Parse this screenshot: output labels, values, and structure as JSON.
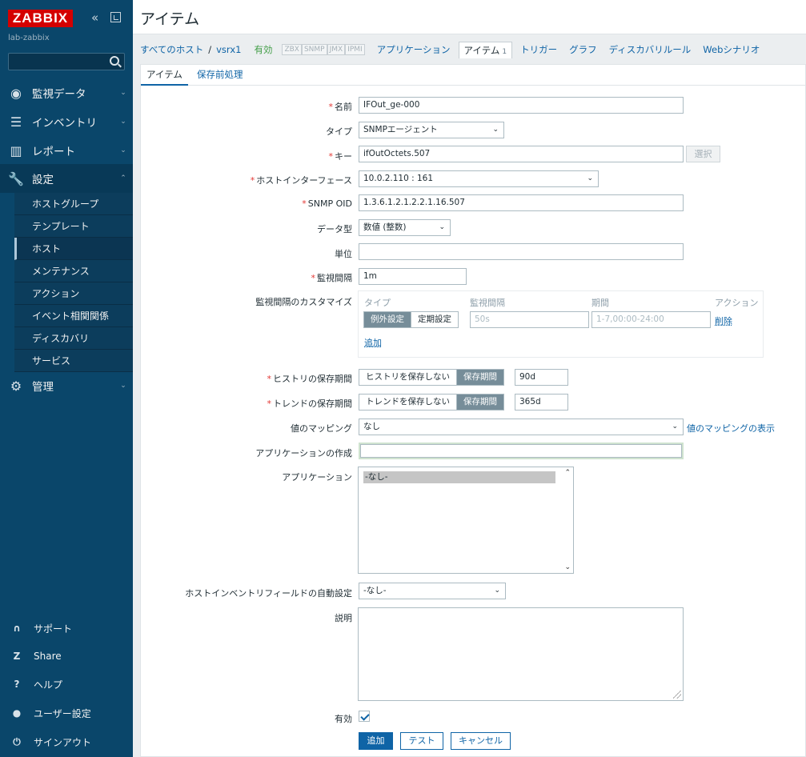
{
  "app": {
    "logo": "ZABBIX",
    "server_name": "lab-zabbix"
  },
  "sidebar": {
    "search_placeholder": "",
    "menu": [
      {
        "label": "監視データ",
        "icon": "eye-icon"
      },
      {
        "label": "インベントリ",
        "icon": "list-icon"
      },
      {
        "label": "レポート",
        "icon": "bar-chart-icon"
      },
      {
        "label": "設定",
        "icon": "wrench-icon"
      },
      {
        "label": "管理",
        "icon": "gear-icon"
      }
    ],
    "submenu": [
      "ホストグループ",
      "テンプレート",
      "ホスト",
      "メンテナンス",
      "アクション",
      "イベント相関関係",
      "ディスカバリ",
      "サービス"
    ],
    "bottom": [
      {
        "label": "サポート",
        "icon": "headset-icon"
      },
      {
        "label": "Share",
        "icon": "share-icon"
      },
      {
        "label": "ヘルプ",
        "icon": "help-icon"
      },
      {
        "label": "ユーザー設定",
        "icon": "user-icon"
      },
      {
        "label": "サインアウト",
        "icon": "power-icon"
      }
    ]
  },
  "page": {
    "title": "アイテム"
  },
  "breadcrumb": {
    "all_hosts": "すべてのホスト",
    "sep": "/",
    "host": "vsrx1",
    "status": "有効",
    "tags": [
      "ZBX",
      "SNMP",
      "JMX",
      "IPMI"
    ],
    "nav": [
      "アプリケーション",
      "アイテム",
      "トリガー",
      "グラフ",
      "ディスカバリルール",
      "Webシナリオ"
    ],
    "item_count": "1"
  },
  "tabs": [
    "アイテム",
    "保存前処理"
  ],
  "form": {
    "name_label": "名前",
    "name_value": "IFOut_ge-000",
    "type_label": "タイプ",
    "type_value": "SNMPエージェント",
    "key_label": "キー",
    "key_value": "ifOutOctets.507",
    "select_button": "選択",
    "interface_label": "ホストインターフェース",
    "interface_value": "10.0.2.110 : 161",
    "oid_label": "SNMP OID",
    "oid_value": "1.3.6.1.2.1.2.2.1.16.507",
    "datatype_label": "データ型",
    "datatype_value": "数値 (整数)",
    "units_label": "単位",
    "units_value": "",
    "interval_label": "監視間隔",
    "interval_value": "1m",
    "custom_label": "監視間隔のカスタマイズ",
    "custom_head_type": "タイプ",
    "custom_head_interval": "監視間隔",
    "custom_head_period": "期間",
    "custom_head_action": "アクション",
    "custom_opt_flexible": "例外設定",
    "custom_opt_scheduling": "定期設定",
    "custom_interval_placeholder": "50s",
    "custom_period_placeholder": "1-7,00:00-24:00",
    "custom_remove": "削除",
    "custom_add": "追加",
    "history_label": "ヒストリの保存期間",
    "history_opt_no": "ヒストリを保存しない",
    "history_opt_period": "保存期間",
    "history_value": "90d",
    "trend_label": "トレンドの保存期間",
    "trend_opt_no": "トレンドを保存しない",
    "trend_opt_period": "保存期間",
    "trend_value": "365d",
    "valuemap_label": "値のマッピング",
    "valuemap_value": "なし",
    "valuemap_link": "値のマッピングの表示",
    "newapp_label": "アプリケーションの作成",
    "newapp_value": "",
    "apps_label": "アプリケーション",
    "apps_option": "-なし-",
    "inventory_label": "ホストインベントリフィールドの自動設定",
    "inventory_value": "-なし-",
    "description_label": "説明",
    "enabled_label": "有効",
    "btn_add": "追加",
    "btn_test": "テスト",
    "btn_cancel": "キャンセル"
  },
  "colors": {
    "accent": "#0f64a6",
    "sidebar": "#0a466a",
    "logo": "#d40000",
    "required": "#e33734",
    "status_enabled": "#429e47"
  }
}
